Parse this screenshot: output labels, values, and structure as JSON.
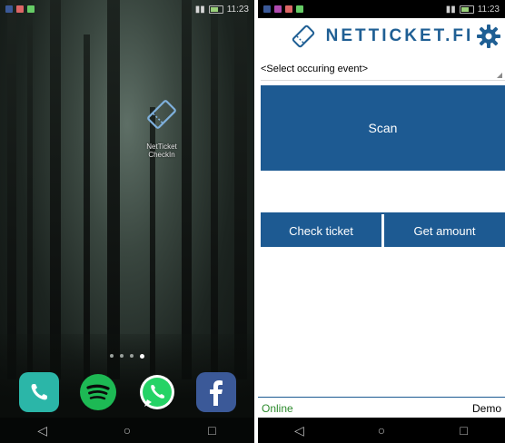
{
  "home": {
    "status_time": "11:23",
    "app_icon": {
      "icon": "ticket-icon",
      "label_line1": "NetTicket",
      "label_line2": "CheckIn"
    },
    "page_dots": {
      "count": 4,
      "active_index": 3
    },
    "dock": [
      {
        "icon": "phone-icon",
        "color": "#2bb6a8"
      },
      {
        "icon": "spotify-icon",
        "color": "#1db954"
      },
      {
        "icon": "whatsapp-icon",
        "color": "#25d366"
      },
      {
        "icon": "facebook-icon",
        "color": "#3b5998"
      }
    ],
    "navbar": {
      "back": "◁",
      "home": "○",
      "recents": "□"
    }
  },
  "app": {
    "status_time": "11:23",
    "brand_text": "NETTICKET.FI",
    "brand_color": "#1f5f94",
    "event_select_value": "<Select occuring event>",
    "scan_label": "Scan",
    "ticket_input_value": "",
    "check_ticket_label": "Check ticket",
    "get_amount_label": "Get amount",
    "status_online": "Online",
    "status_mode": "Demo",
    "accent_color": "#1d5a92",
    "navbar": {
      "back": "◁",
      "home": "○",
      "recents": "□"
    }
  }
}
